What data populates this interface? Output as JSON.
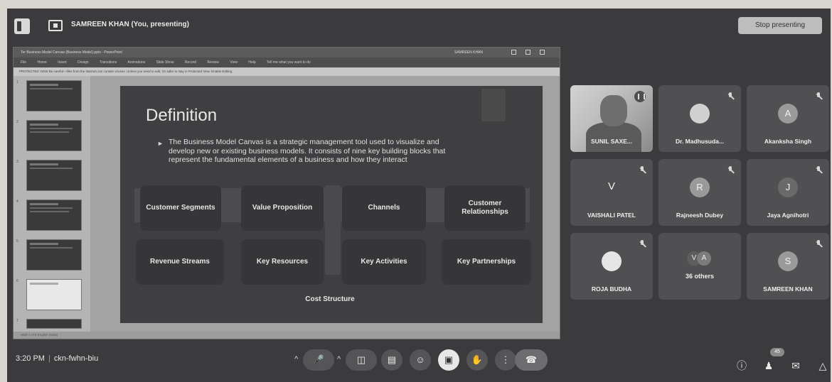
{
  "topbar": {
    "presenter_label": "SAMREEN KHAN (You, presenting)",
    "stop_button": "Stop presenting"
  },
  "ppt": {
    "window_title": "Ter Business Model Canvas (Business Model).pptx - PowerPoint",
    "account": "SAMREEN KHAN",
    "ribbon_tabs": [
      "File",
      "Home",
      "Insert",
      "Design",
      "Transitions",
      "Animations",
      "Slide Show",
      "Record",
      "Review",
      "View",
      "Help",
      "Tell me what you want to do"
    ],
    "info_bar": "PROTECTED VIEW  Be careful—files from the Internet can contain viruses. Unless you need to edit, it's safer to stay in Protected View.   Enable Editing",
    "status_bar": "Slide 1 of 8   English (India)",
    "slide_numbers": [
      "1",
      "2",
      "3",
      "4",
      "5",
      "6",
      "7"
    ]
  },
  "slide": {
    "heading": "Definition",
    "bullet": "The Business Model Canvas is a strategic management tool used to visualize and develop new or existing business models. It consists of nine key building blocks that represent the fundamental elements of a business and how they interact",
    "blocks": {
      "customer_segments": "Customer Segments",
      "value_proposition": "Value Proposition",
      "channels": "Channels",
      "customer_relationships": "Customer Relationships",
      "revenue_streams": "Revenue Streams",
      "key_resources": "Key Resources",
      "key_activities": "Key Activities",
      "key_partnerships": "Key Partnerships",
      "cost_structure": "Cost Structure"
    }
  },
  "participants": [
    {
      "name": "SUNIL SAXE...",
      "initial": ""
    },
    {
      "name": "Dr. Madhusuda...",
      "initial": ""
    },
    {
      "name": "Akanksha Singh",
      "initial": "A"
    },
    {
      "name": "VAISHALI PATEL",
      "initial": "V"
    },
    {
      "name": "Rajneesh Dubey",
      "initial": "R"
    },
    {
      "name": "Jaya Agnihotri",
      "initial": "J"
    },
    {
      "name": "ROJA BUDHA",
      "initial": ""
    },
    {
      "name": "36 others",
      "initial_1": "V",
      "initial_2": "A"
    },
    {
      "name": "SAMREEN KHAN",
      "initial": "S"
    }
  ],
  "bottombar": {
    "time": "3:20 PM",
    "meeting_code": "ckn-fwhn-biu",
    "people_count": "45"
  }
}
